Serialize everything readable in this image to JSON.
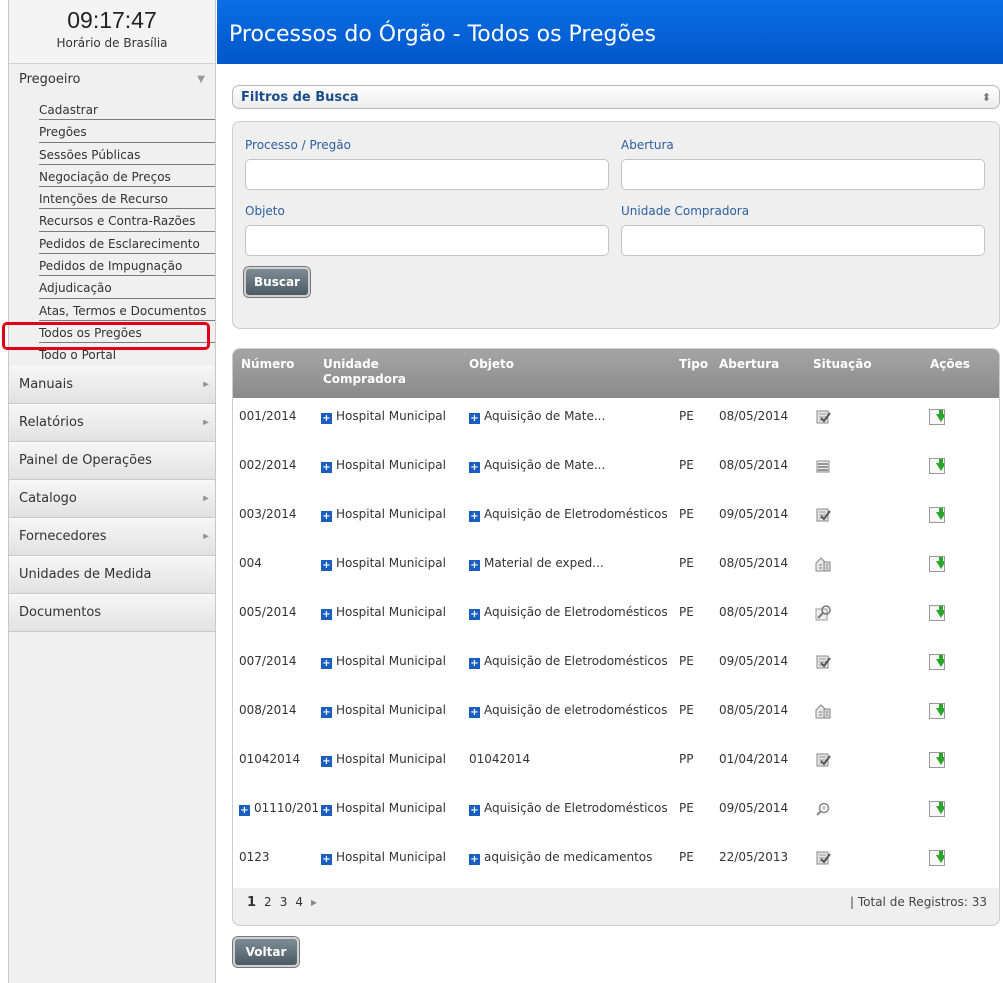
{
  "clock": {
    "time": "09:17:47",
    "timezone": "Horário de Brasília"
  },
  "sidebar": {
    "pregoeiro": {
      "label": "Pregoeiro",
      "items": [
        "Cadastrar",
        "Pregões",
        "Sessões Públicas",
        "Negociação de Preços",
        "Intenções de Recurso",
        "Recursos e Contra-Razões",
        "Pedidos de Esclarecimento",
        "Pedidos de Impugnação",
        "Adjudicação",
        "Atas, Termos e Documentos",
        "Todos os Pregões",
        "Todo o Portal"
      ],
      "selected": "Todos os Pregões"
    },
    "sections": [
      {
        "label": "Manuais",
        "icon": "double-chevron-right-icon"
      },
      {
        "label": "Relatórios",
        "icon": "double-chevron-right-icon"
      },
      {
        "label": "Painel de Operações",
        "icon": ""
      },
      {
        "label": "Catalogo",
        "icon": "double-chevron-right-icon"
      },
      {
        "label": "Fornecedores",
        "icon": "double-chevron-right-icon"
      },
      {
        "label": "Unidades de Medida",
        "icon": ""
      },
      {
        "label": "Documentos",
        "icon": ""
      }
    ]
  },
  "header": {
    "title": "Processos do Órgão - Todos os Pregões"
  },
  "filters": {
    "title": "Filtros de Busca",
    "processo_label": "Processo / Pregão",
    "processo_value": "",
    "abertura_label": "Abertura",
    "abertura_value": "",
    "objeto_label": "Objeto",
    "objeto_value": "",
    "unidade_label": "Unidade Compradora",
    "unidade_value": "",
    "buscar": "Buscar"
  },
  "table": {
    "headers": {
      "numero": "Número",
      "unidade": "Unidade Compradora",
      "objeto": "Objeto",
      "tipo": "Tipo",
      "abertura": "Abertura",
      "situacao": "Situação",
      "acoes": "Ações"
    },
    "rows": [
      {
        "numero": "001/2014",
        "numero_plus": false,
        "unidade": "Hospital Municipal",
        "objeto": "Aquisição de Mate...",
        "objeto_plus": true,
        "tipo": "PE",
        "abertura": "08/05/2014",
        "situacao_icon": "checklist-icon"
      },
      {
        "numero": "002/2014",
        "numero_plus": false,
        "unidade": "Hospital Municipal",
        "objeto": "Aquisição de Mate...",
        "objeto_plus": true,
        "tipo": "PE",
        "abertura": "08/05/2014",
        "situacao_icon": "list-icon"
      },
      {
        "numero": "003/2014",
        "numero_plus": false,
        "unidade": "Hospital Municipal",
        "objeto": "Aquisição de Eletrodomésticos",
        "objeto_plus": true,
        "tipo": "PE",
        "abertura": "09/05/2014",
        "situacao_icon": "checklist-icon"
      },
      {
        "numero": "004",
        "numero_plus": false,
        "unidade": "Hospital Municipal",
        "objeto": "Material de exped...",
        "objeto_plus": true,
        "tipo": "PE",
        "abertura": "08/05/2014",
        "situacao_icon": "building-icon"
      },
      {
        "numero": "005/2014",
        "numero_plus": false,
        "unidade": "Hospital Municipal",
        "objeto": "Aquisição de Eletrodomésticos",
        "objeto_plus": true,
        "tipo": "PE",
        "abertura": "08/05/2014",
        "situacao_icon": "gavel-icon"
      },
      {
        "numero": "007/2014",
        "numero_plus": false,
        "unidade": "Hospital Municipal",
        "objeto": "Aquisição de Eletrodomésticos",
        "objeto_plus": true,
        "tipo": "PE",
        "abertura": "09/05/2014",
        "situacao_icon": "checklist-icon"
      },
      {
        "numero": "008/2014",
        "numero_plus": false,
        "unidade": "Hospital Municipal",
        "objeto": "Aquisição de eletrodomésticos",
        "objeto_plus": true,
        "tipo": "PE",
        "abertura": "08/05/2014",
        "situacao_icon": "building-icon"
      },
      {
        "numero": "01042014",
        "numero_plus": false,
        "unidade": "Hospital Municipal",
        "objeto": "01042014",
        "objeto_plus": false,
        "tipo": "PP",
        "abertura": "01/04/2014",
        "situacao_icon": "checklist-icon"
      },
      {
        "numero": "01110/201",
        "numero_plus": true,
        "unidade": "Hospital Municipal",
        "objeto": "Aquisição de Eletrodomésticos",
        "objeto_plus": true,
        "tipo": "PE",
        "abertura": "09/05/2014",
        "situacao_icon": "magnifier-icon"
      },
      {
        "numero": "0123",
        "numero_plus": false,
        "unidade": "Hospital Municipal",
        "objeto": "aquisição de medicamentos",
        "objeto_plus": true,
        "tipo": "PE",
        "abertura": "22/05/2013",
        "situacao_icon": "checklist-icon"
      }
    ],
    "action_icon": "download-icon"
  },
  "pagination": {
    "pages": [
      "1",
      "2",
      "3",
      "4"
    ],
    "current": "1",
    "next": "▸",
    "total": "| Total de Registros: 33"
  },
  "voltar": "Voltar",
  "colors": {
    "header_blue": "#0a64d8",
    "highlight_red": "#e1001a",
    "link_blue": "#1a4d8c",
    "plus_blue": "#1a5fc0",
    "download_green": "#2aa52a"
  }
}
